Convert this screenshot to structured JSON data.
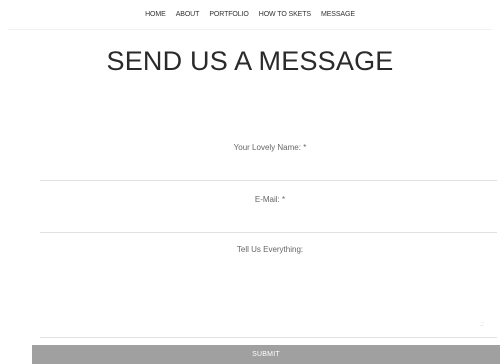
{
  "nav": {
    "items": [
      {
        "label": "HOME"
      },
      {
        "label": "ABOUT"
      },
      {
        "label": "PORTFOLIO"
      },
      {
        "label": "HOW TO SKETS"
      },
      {
        "label": "MESSAGE"
      }
    ]
  },
  "page": {
    "title": "SEND US A MESSAGE"
  },
  "form": {
    "name_label": "Your Lovely Name: *",
    "name_value": "",
    "email_label": "E-Mail: *",
    "email_value": "",
    "message_label": "Tell Us Everything:",
    "message_value": "",
    "submit_label": "SUBMIT"
  },
  "colors": {
    "submit_background": "#a0a0a0",
    "field_border": "#e2e2e2",
    "title_text": "#2a2a2a"
  },
  "icons": {
    "textarea_resize": "resize-grip-icon"
  }
}
